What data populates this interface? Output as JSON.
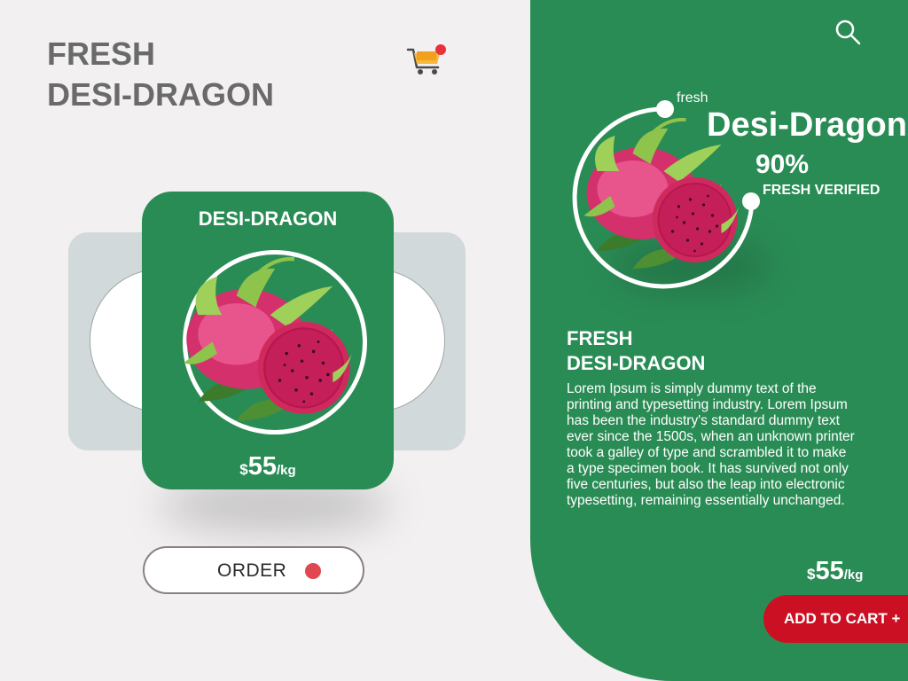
{
  "header": {
    "title_line1": "FRESH",
    "title_line2": "DESI-DRAGON",
    "cart_icon": "shopping-cart-icon",
    "notification_badge_color": "#e8313b"
  },
  "product_card": {
    "name": "DESI-DRAGON",
    "image": "dragon-fruit-image",
    "price": {
      "currency": "$",
      "amount": "55",
      "unit": "/kg"
    }
  },
  "order_button": {
    "label": "ORDER",
    "dot_color": "#e0474f"
  },
  "detail_panel": {
    "search_icon": "search-icon",
    "hero": {
      "small_label": "fresh",
      "name": "Desi-Dragon",
      "percent": "90%",
      "verified_label": "FRESH VERIFIED"
    },
    "title_line1": "FRESH",
    "title_line2": "DESI-DRAGON",
    "description": "Lorem Ipsum is simply dummy text of the printing and typesetting industry. Lorem Ipsum has been the industry's standard dummy text ever since the 1500s, when an unknown printer took a galley of type and scrambled it to make a type specimen book. It has survived not only five centuries, but also the leap into electronic typesetting, remaining essentially unchanged.",
    "price": {
      "currency": "$",
      "amount": "55",
      "unit": "/kg"
    },
    "add_to_cart_label": "ADD TO CART +"
  },
  "colors": {
    "brand_green": "#2a8c55",
    "accent_red": "#cc1023",
    "page_bg": "#f2f0f1",
    "title_gray": "#6a6a6a"
  }
}
